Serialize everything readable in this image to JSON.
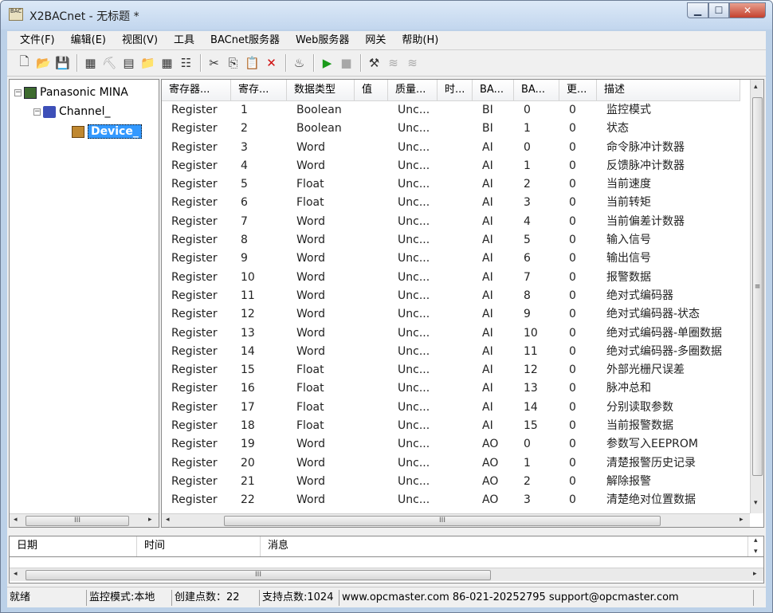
{
  "window": {
    "title": "X2BACnet - 无标题 *",
    "icon_text": "BAC"
  },
  "menu": [
    "文件(F)",
    "编辑(E)",
    "视图(V)",
    "工具",
    "BACnet服务器",
    "Web服务器",
    "网关",
    "帮助(H)"
  ],
  "toolbar": {
    "icons": [
      "new-file-icon",
      "open-folder-icon",
      "save-icon",
      "separator",
      "add-channel-icon",
      "add-device-icon",
      "add-point-icon",
      "import-icon",
      "device-config-icon",
      "properties-icon",
      "separator",
      "cut-icon",
      "copy-icon",
      "paste-icon",
      "delete-icon",
      "separator",
      "monitor-icon",
      "separator",
      "run-icon",
      "stop-icon",
      "separator",
      "tools-icon",
      "grid-icon",
      "grid2-icon"
    ],
    "glyphs": [
      "🗋",
      "📂",
      "💾",
      "|",
      "▦",
      "⛏",
      "▤",
      "📁",
      "▦",
      "☷",
      "|",
      "✂",
      "⎘",
      "📋",
      "✕",
      "|",
      "♨",
      "|",
      "▶",
      "■",
      "|",
      "⚒",
      "≋",
      "≋"
    ]
  },
  "tree": {
    "root": "Panasonic MINA",
    "channel": "Channel_",
    "device": "Device_",
    "expanded_marker": "−"
  },
  "columns": [
    "寄存器...",
    "寄存...",
    "数据类型",
    "值",
    "质量...",
    "时...",
    "BA...",
    "BA...",
    "更...",
    "描述"
  ],
  "rows": [
    [
      "Register",
      "1",
      "Boolean",
      "",
      "Unc...",
      "",
      "BI",
      "0",
      "0",
      "监控模式"
    ],
    [
      "Register",
      "2",
      "Boolean",
      "",
      "Unc...",
      "",
      "BI",
      "1",
      "0",
      "状态"
    ],
    [
      "Register",
      "3",
      "Word",
      "",
      "Unc...",
      "",
      "AI",
      "0",
      "0",
      "命令脉冲计数器"
    ],
    [
      "Register",
      "4",
      "Word",
      "",
      "Unc...",
      "",
      "AI",
      "1",
      "0",
      "反馈脉冲计数器"
    ],
    [
      "Register",
      "5",
      "Float",
      "",
      "Unc...",
      "",
      "AI",
      "2",
      "0",
      "当前速度"
    ],
    [
      "Register",
      "6",
      "Float",
      "",
      "Unc...",
      "",
      "AI",
      "3",
      "0",
      "当前转矩"
    ],
    [
      "Register",
      "7",
      "Word",
      "",
      "Unc...",
      "",
      "AI",
      "4",
      "0",
      "当前偏差计数器"
    ],
    [
      "Register",
      "8",
      "Word",
      "",
      "Unc...",
      "",
      "AI",
      "5",
      "0",
      "输入信号"
    ],
    [
      "Register",
      "9",
      "Word",
      "",
      "Unc...",
      "",
      "AI",
      "6",
      "0",
      "输出信号"
    ],
    [
      "Register",
      "10",
      "Word",
      "",
      "Unc...",
      "",
      "AI",
      "7",
      "0",
      "报警数据"
    ],
    [
      "Register",
      "11",
      "Word",
      "",
      "Unc...",
      "",
      "AI",
      "8",
      "0",
      "绝对式编码器"
    ],
    [
      "Register",
      "12",
      "Word",
      "",
      "Unc...",
      "",
      "AI",
      "9",
      "0",
      "绝对式编码器-状态"
    ],
    [
      "Register",
      "13",
      "Word",
      "",
      "Unc...",
      "",
      "AI",
      "10",
      "0",
      "绝对式编码器-单圈数据"
    ],
    [
      "Register",
      "14",
      "Word",
      "",
      "Unc...",
      "",
      "AI",
      "11",
      "0",
      "绝对式编码器-多圈数据"
    ],
    [
      "Register",
      "15",
      "Float",
      "",
      "Unc...",
      "",
      "AI",
      "12",
      "0",
      "外部光栅尺误差"
    ],
    [
      "Register",
      "16",
      "Float",
      "",
      "Unc...",
      "",
      "AI",
      "13",
      "0",
      "脉冲总和"
    ],
    [
      "Register",
      "17",
      "Float",
      "",
      "Unc...",
      "",
      "AI",
      "14",
      "0",
      "分别读取参数"
    ],
    [
      "Register",
      "18",
      "Float",
      "",
      "Unc...",
      "",
      "AI",
      "15",
      "0",
      "当前报警数据"
    ],
    [
      "Register",
      "19",
      "Word",
      "",
      "Unc...",
      "",
      "AO",
      "0",
      "0",
      "参数写入EEPROM"
    ],
    [
      "Register",
      "20",
      "Word",
      "",
      "Unc...",
      "",
      "AO",
      "1",
      "0",
      "清楚报警历史记录"
    ],
    [
      "Register",
      "21",
      "Word",
      "",
      "Unc...",
      "",
      "AO",
      "2",
      "0",
      "解除报警"
    ],
    [
      "Register",
      "22",
      "Word",
      "",
      "Unc...",
      "",
      "AO",
      "3",
      "0",
      "清楚绝对位置数据"
    ]
  ],
  "log": {
    "columns": [
      "日期",
      "时间",
      "消息"
    ]
  },
  "scroll": {
    "thumb_glyph_h": "III",
    "thumb_glyph_v": "≡",
    "left": "◂",
    "right": "▸",
    "up": "▴",
    "down": "▾"
  },
  "status": [
    "就绪",
    "监控模式:本地",
    "创建点数：22",
    "支持点数:1024",
    "www.opcmaster.com 86-021-20252795 support@opcmaster.com"
  ]
}
